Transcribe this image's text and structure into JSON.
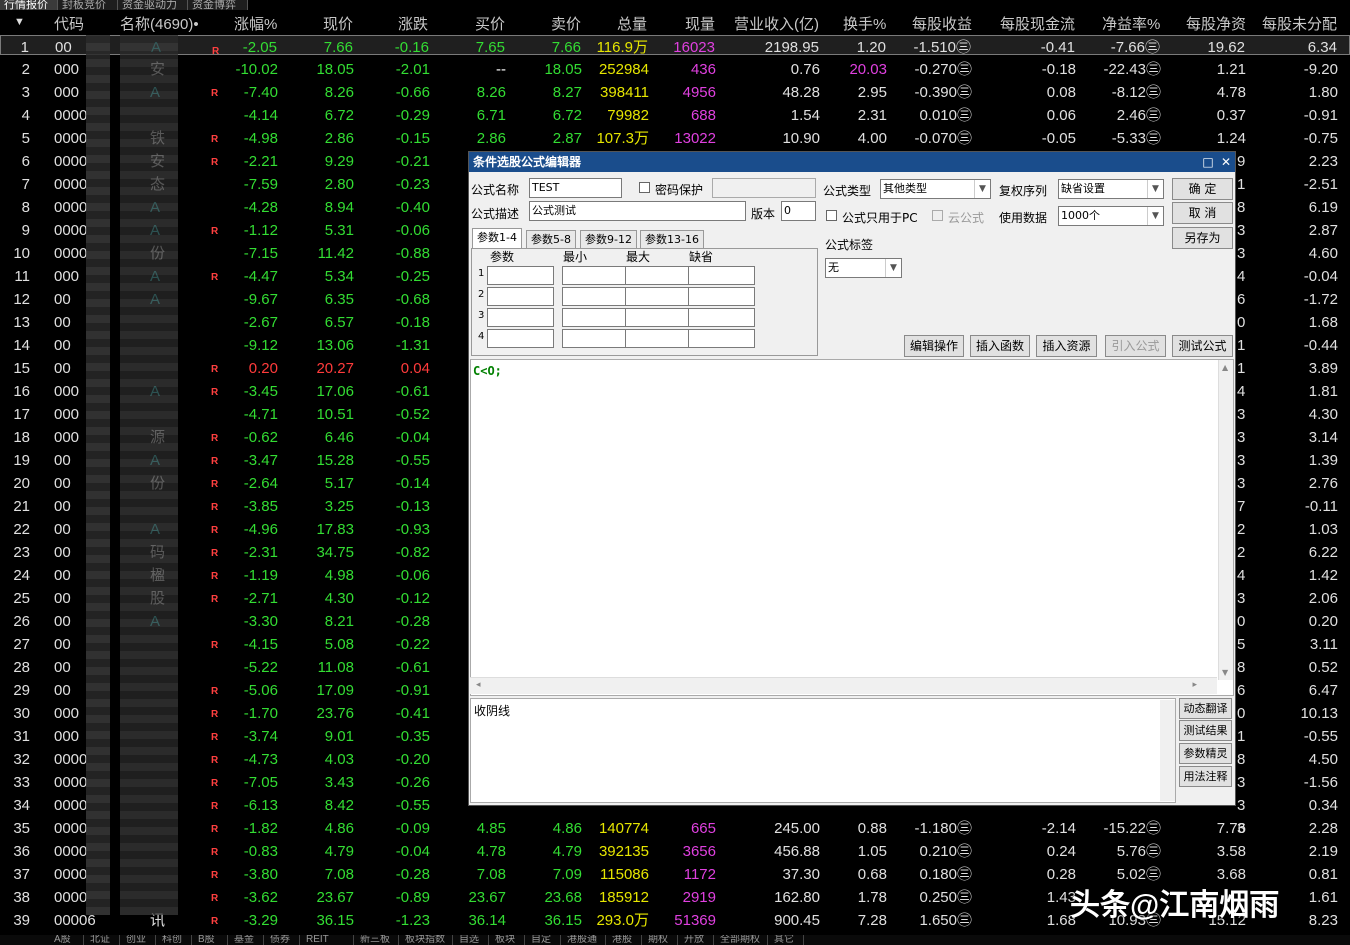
{
  "top_tabs": [
    "行情报价",
    "封板竞价",
    "资金驱动力",
    "资金博弈"
  ],
  "columns": [
    "代码",
    "名称(4690)•",
    "",
    "涨幅%",
    "现价",
    "涨跌",
    "买价",
    "卖价",
    "总量",
    "现量",
    "营业收入(亿)",
    "换手%",
    "每股收益",
    "每股现金流",
    "净益率%",
    "每股净资",
    "每股未分配"
  ],
  "colors": {
    "up": "#ff3b3b",
    "down": "#33dd33",
    "yellow": "#e6e600",
    "magenta": "#e040e0",
    "white": "#ffffff",
    "cyan": "#33cccc"
  },
  "rows": [
    {
      "n": "1",
      "code": "00",
      "name": "A",
      "r": "R",
      "pct": "-2.05",
      "price": "7.66",
      "chg": "-0.16",
      "bid": "7.65",
      "ask": "7.66",
      "vol": "116.9万",
      "cur": "16023",
      "rev": "2198.95",
      "turn": "1.20",
      "eps": "-1.510㊂",
      "cf": "-0.41",
      "roe": "-7.66㊂",
      "bps": "19.62",
      "und": "6.34"
    },
    {
      "n": "2",
      "code": "000",
      "name": "安",
      "r": "",
      "pct": "-10.02",
      "price": "18.05",
      "chg": "-2.01",
      "bid": "--",
      "ask": "18.05",
      "vol": "252984",
      "cur": "436",
      "rev": "0.76",
      "turn": "20.03",
      "eps": "-0.270㊂",
      "cf": "-0.18",
      "roe": "-22.43㊂",
      "bps": "1.21",
      "und": "-9.20"
    },
    {
      "n": "3",
      "code": "000",
      "name": "A",
      "r": "R",
      "pct": "-7.40",
      "price": "8.26",
      "chg": "-0.66",
      "bid": "8.26",
      "ask": "8.27",
      "vol": "398411",
      "cur": "4956",
      "rev": "48.28",
      "turn": "2.95",
      "eps": "-0.390㊂",
      "cf": "0.08",
      "roe": "-8.12㊂",
      "bps": "4.78",
      "und": "1.80"
    },
    {
      "n": "4",
      "code": "0000",
      "name": "",
      "r": "",
      "pct": "-4.14",
      "price": "6.72",
      "chg": "-0.29",
      "bid": "6.71",
      "ask": "6.72",
      "vol": "79982",
      "cur": "688",
      "rev": "1.54",
      "turn": "2.31",
      "eps": "0.010㊂",
      "cf": "0.06",
      "roe": "2.46㊂",
      "bps": "0.37",
      "und": "-0.91"
    },
    {
      "n": "5",
      "code": "0000",
      "name": "铁",
      "r": "R",
      "pct": "-4.98",
      "price": "2.86",
      "chg": "-0.15",
      "bid": "2.86",
      "ask": "2.87",
      "vol": "107.3万",
      "cur": "13022",
      "rev": "10.90",
      "turn": "4.00",
      "eps": "-0.070㊂",
      "cf": "-0.05",
      "roe": "-5.33㊂",
      "bps": "1.24",
      "und": "-0.75"
    },
    {
      "n": "6",
      "code": "0000",
      "name": "安",
      "r": "R",
      "pct": "-2.21",
      "price": "9.29",
      "chg": "-0.21",
      "und": "2.23"
    },
    {
      "n": "7",
      "code": "0000",
      "name": "态",
      "r": "",
      "pct": "-7.59",
      "price": "2.80",
      "chg": "-0.23",
      "und": "-2.51"
    },
    {
      "n": "8",
      "code": "0000",
      "name": "A",
      "r": "",
      "pct": "-4.28",
      "price": "8.94",
      "chg": "-0.40",
      "und": "6.19"
    },
    {
      "n": "9",
      "code": "0000",
      "name": "A",
      "r": "R",
      "pct": "-1.12",
      "price": "5.31",
      "chg": "-0.06",
      "und": "2.87"
    },
    {
      "n": "10",
      "code": "0000",
      "name": "份",
      "r": "",
      "pct": "-7.15",
      "price": "11.42",
      "chg": "-0.88",
      "und": "4.60"
    },
    {
      "n": "11",
      "code": "000",
      "name": "A",
      "r": "R",
      "pct": "-4.47",
      "price": "5.34",
      "chg": "-0.25",
      "und": "-0.04"
    },
    {
      "n": "12",
      "code": "00",
      "name": "A",
      "r": "",
      "pct": "-9.67",
      "price": "6.35",
      "chg": "-0.68",
      "und": "-1.72"
    },
    {
      "n": "13",
      "code": "00",
      "name": "",
      "r": "",
      "pct": "-2.67",
      "price": "6.57",
      "chg": "-0.18",
      "und": "1.68"
    },
    {
      "n": "14",
      "code": "00",
      "name": "",
      "r": "",
      "pct": "-9.12",
      "price": "13.06",
      "chg": "-1.31",
      "und": "-0.44"
    },
    {
      "n": "15",
      "code": "00",
      "name": "",
      "r": "R",
      "pct": "0.20",
      "price": "20.27",
      "chg": "0.04",
      "und": "3.89"
    },
    {
      "n": "16",
      "code": "000",
      "name": "A",
      "r": "R",
      "pct": "-3.45",
      "price": "17.06",
      "chg": "-0.61",
      "und": "1.81"
    },
    {
      "n": "17",
      "code": "000",
      "name": "",
      "r": "",
      "pct": "-4.71",
      "price": "10.51",
      "chg": "-0.52",
      "und": "4.30"
    },
    {
      "n": "18",
      "code": "000",
      "name": "源",
      "r": "R",
      "pct": "-0.62",
      "price": "6.46",
      "chg": "-0.04",
      "und": "3.14"
    },
    {
      "n": "19",
      "code": "00",
      "name": "A",
      "r": "R",
      "pct": "-3.47",
      "price": "15.28",
      "chg": "-0.55",
      "und": "1.39"
    },
    {
      "n": "20",
      "code": "00",
      "name": "份",
      "r": "R",
      "pct": "-2.64",
      "price": "5.17",
      "chg": "-0.14",
      "und": "2.76"
    },
    {
      "n": "21",
      "code": "00",
      "name": "",
      "r": "R",
      "pct": "-3.85",
      "price": "3.25",
      "chg": "-0.13",
      "und": "-0.11"
    },
    {
      "n": "22",
      "code": "00",
      "name": "A",
      "r": "R",
      "pct": "-4.96",
      "price": "17.83",
      "chg": "-0.93",
      "und": "1.03"
    },
    {
      "n": "23",
      "code": "00",
      "name": "码",
      "r": "R",
      "pct": "-2.31",
      "price": "34.75",
      "chg": "-0.82",
      "und": "6.22"
    },
    {
      "n": "24",
      "code": "00",
      "name": "楹",
      "r": "R",
      "pct": "-1.19",
      "price": "4.98",
      "chg": "-0.06",
      "und": "1.42"
    },
    {
      "n": "25",
      "code": "00",
      "name": "股",
      "r": "R",
      "pct": "-2.71",
      "price": "4.30",
      "chg": "-0.12",
      "und": "2.06"
    },
    {
      "n": "26",
      "code": "00",
      "name": "A",
      "r": "",
      "pct": "-3.30",
      "price": "8.21",
      "chg": "-0.28",
      "und": "0.20"
    },
    {
      "n": "27",
      "code": "00",
      "name": "",
      "r": "R",
      "pct": "-4.15",
      "price": "5.08",
      "chg": "-0.22",
      "und": "3.11"
    },
    {
      "n": "28",
      "code": "00",
      "name": "",
      "r": "",
      "pct": "-5.22",
      "price": "11.08",
      "chg": "-0.61",
      "und": "0.52"
    },
    {
      "n": "29",
      "code": "00",
      "name": "",
      "r": "R",
      "pct": "-5.06",
      "price": "17.09",
      "chg": "-0.91",
      "und": "6.47"
    },
    {
      "n": "30",
      "code": "000",
      "name": "",
      "r": "R",
      "pct": "-1.70",
      "price": "23.76",
      "chg": "-0.41",
      "und": "10.13"
    },
    {
      "n": "31",
      "code": "000",
      "name": "",
      "r": "R",
      "pct": "-3.74",
      "price": "9.01",
      "chg": "-0.35",
      "und": "-0.55"
    },
    {
      "n": "32",
      "code": "0000",
      "name": "",
      "r": "R",
      "pct": "-4.73",
      "price": "4.03",
      "chg": "-0.20",
      "und": "4.50"
    },
    {
      "n": "33",
      "code": "0000",
      "name": "",
      "r": "R",
      "pct": "-7.05",
      "price": "3.43",
      "chg": "-0.26",
      "und": "-1.56"
    },
    {
      "n": "34",
      "code": "0000",
      "name": "",
      "r": "R",
      "pct": "-6.13",
      "price": "8.42",
      "chg": "-0.55",
      "und": "0.34"
    },
    {
      "n": "35",
      "code": "0000",
      "name": "",
      "r": "R",
      "pct": "-1.82",
      "price": "4.86",
      "chg": "-0.09",
      "bid": "4.85",
      "ask": "4.86",
      "vol": "140774",
      "cur": "665",
      "rev": "245.00",
      "turn": "0.88",
      "eps": "-1.180㊂",
      "cf": "-2.14",
      "roe": "-15.22㊂",
      "bps": "7.76",
      "und": "2.28"
    },
    {
      "n": "36",
      "code": "0000",
      "name": "",
      "r": "R",
      "pct": "-0.83",
      "price": "4.79",
      "chg": "-0.04",
      "bid": "4.78",
      "ask": "4.79",
      "vol": "392135",
      "cur": "3656",
      "rev": "456.88",
      "turn": "1.05",
      "eps": "0.210㊂",
      "cf": "0.24",
      "roe": "5.76㊂",
      "bps": "3.58",
      "und": "2.19"
    },
    {
      "n": "37",
      "code": "0000",
      "name": "",
      "r": "R",
      "pct": "-3.80",
      "price": "7.08",
      "chg": "-0.28",
      "bid": "7.08",
      "ask": "7.09",
      "vol": "115086",
      "cur": "1172",
      "rev": "37.30",
      "turn": "0.68",
      "eps": "0.180㊂",
      "cf": "0.28",
      "roe": "5.02㊂",
      "bps": "3.68",
      "und": "0.81"
    },
    {
      "n": "38",
      "code": "0000",
      "name": "",
      "r": "R",
      "pct": "-3.62",
      "price": "23.67",
      "chg": "-0.89",
      "bid": "23.67",
      "ask": "23.68",
      "vol": "185912",
      "cur": "2919",
      "rev": "162.80",
      "turn": "1.78",
      "eps": "0.250㊂",
      "cf": "1.43",
      "roe": "",
      "bps": "",
      "und": "1.61"
    },
    {
      "n": "39",
      "code": "00006",
      "name": "讯",
      "r": "R",
      "pct": "-3.29",
      "price": "36.15",
      "chg": "-1.23",
      "bid": "36.14",
      "ask": "36.15",
      "vol": "293.0万",
      "cur": "51369",
      "rev": "900.45",
      "turn": "7.28",
      "eps": "1.650㊂",
      "cf": "1.68",
      "roe": "10.93㊂",
      "bps": "15.12",
      "und": "8.23"
    }
  ],
  "right_edge_digits": [
    "9",
    "1",
    "8",
    "3",
    "3",
    "4",
    "6",
    "0",
    "1",
    "1",
    "4",
    "3",
    "3",
    "3",
    "3",
    "7",
    "2",
    "2",
    "4",
    "3",
    "0",
    "5",
    "8",
    "6",
    "0",
    "1",
    "8",
    "3",
    "3",
    "3"
  ],
  "dialog": {
    "title": "条件选股公式编辑器",
    "formula_name_label": "公式名称",
    "formula_name": "TEST",
    "password_label": "密码保护",
    "formula_type_label": "公式类型",
    "formula_type": "其他类型",
    "rights_label": "复权序列",
    "rights_value": "缺省设置",
    "ok": "确  定",
    "desc_label": "公式描述",
    "desc": "公式测试",
    "version_label": "版本",
    "version": "0",
    "pc_only_label": "公式只用于PC",
    "cloud_label": "云公式",
    "use_data_label": "使用数据",
    "use_data": "1000个",
    "cancel": "取  消",
    "save_as": "另存为",
    "tabs": [
      "参数1-4",
      "参数5-8",
      "参数9-12",
      "参数13-16"
    ],
    "param_headers": [
      "参数",
      "最小",
      "最大",
      "缺省"
    ],
    "param_rows": [
      "1",
      "2",
      "3",
      "4"
    ],
    "tag_label": "公式标签",
    "tag_value": "无",
    "edit_op": "编辑操作",
    "insert_fn": "插入函数",
    "insert_res": "插入资源",
    "import_formula": "引入公式",
    "test_formula": "测试公式",
    "code": "C<O;",
    "note": "收阴线",
    "side_buttons": [
      "动态翻译",
      "测试结果",
      "参数精灵",
      "用法注释"
    ]
  },
  "bottom_tabs": [
    "A股",
    "北证",
    "创业",
    "科创",
    "B股",
    "基金",
    "债券",
    "REIT",
    "新三板",
    "板块指数",
    "自选",
    "板块",
    "自定",
    "港股通",
    "港股",
    "期权",
    "开放",
    "全部期权",
    "其它"
  ],
  "watermark": "头条@江南烟雨"
}
